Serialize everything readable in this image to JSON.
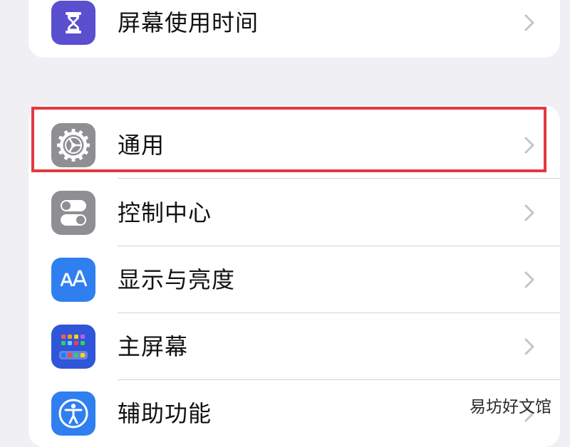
{
  "settings": {
    "top_group": [
      {
        "label": "屏幕使用时间",
        "icon": "hourglass-icon",
        "icon_color": "#5a4fcf"
      }
    ],
    "main_group": [
      {
        "label": "通用",
        "icon": "gear-icon",
        "icon_color": "#8e8e93",
        "highlighted": true
      },
      {
        "label": "控制中心",
        "icon": "toggle-switches-icon",
        "icon_color": "#8e8e93"
      },
      {
        "label": "显示与亮度",
        "icon": "text-size-icon",
        "icon_color": "#2f7ff0"
      },
      {
        "label": "主屏幕",
        "icon": "home-screen-grid-icon",
        "icon_color": "#2f55d8"
      },
      {
        "label": "辅助功能",
        "icon": "accessibility-icon",
        "icon_color": "#2f7ff0"
      }
    ]
  },
  "highlight_color": "#e5383f",
  "watermark": "易坊好文馆"
}
